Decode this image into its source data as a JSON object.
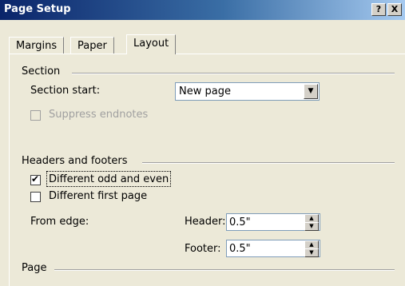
{
  "window": {
    "title": "Page Setup",
    "help_label": "?",
    "close_label": "X"
  },
  "tabs": [
    {
      "label": "Margins"
    },
    {
      "label": "Paper"
    },
    {
      "label": "Layout"
    }
  ],
  "section": {
    "heading": "Section",
    "start_label": "Section start:",
    "start_value": "New page",
    "suppress_label": "Suppress endnotes"
  },
  "headers_footers": {
    "heading": "Headers and footers",
    "odd_even_label": "Different odd and even",
    "odd_even_checked": true,
    "first_page_label": "Different first page",
    "first_page_checked": false,
    "from_edge_label": "From edge:",
    "header_label": "Header:",
    "header_value": "0.5\"",
    "footer_label": "Footer:",
    "footer_value": "0.5\""
  },
  "page": {
    "heading": "Page"
  }
}
